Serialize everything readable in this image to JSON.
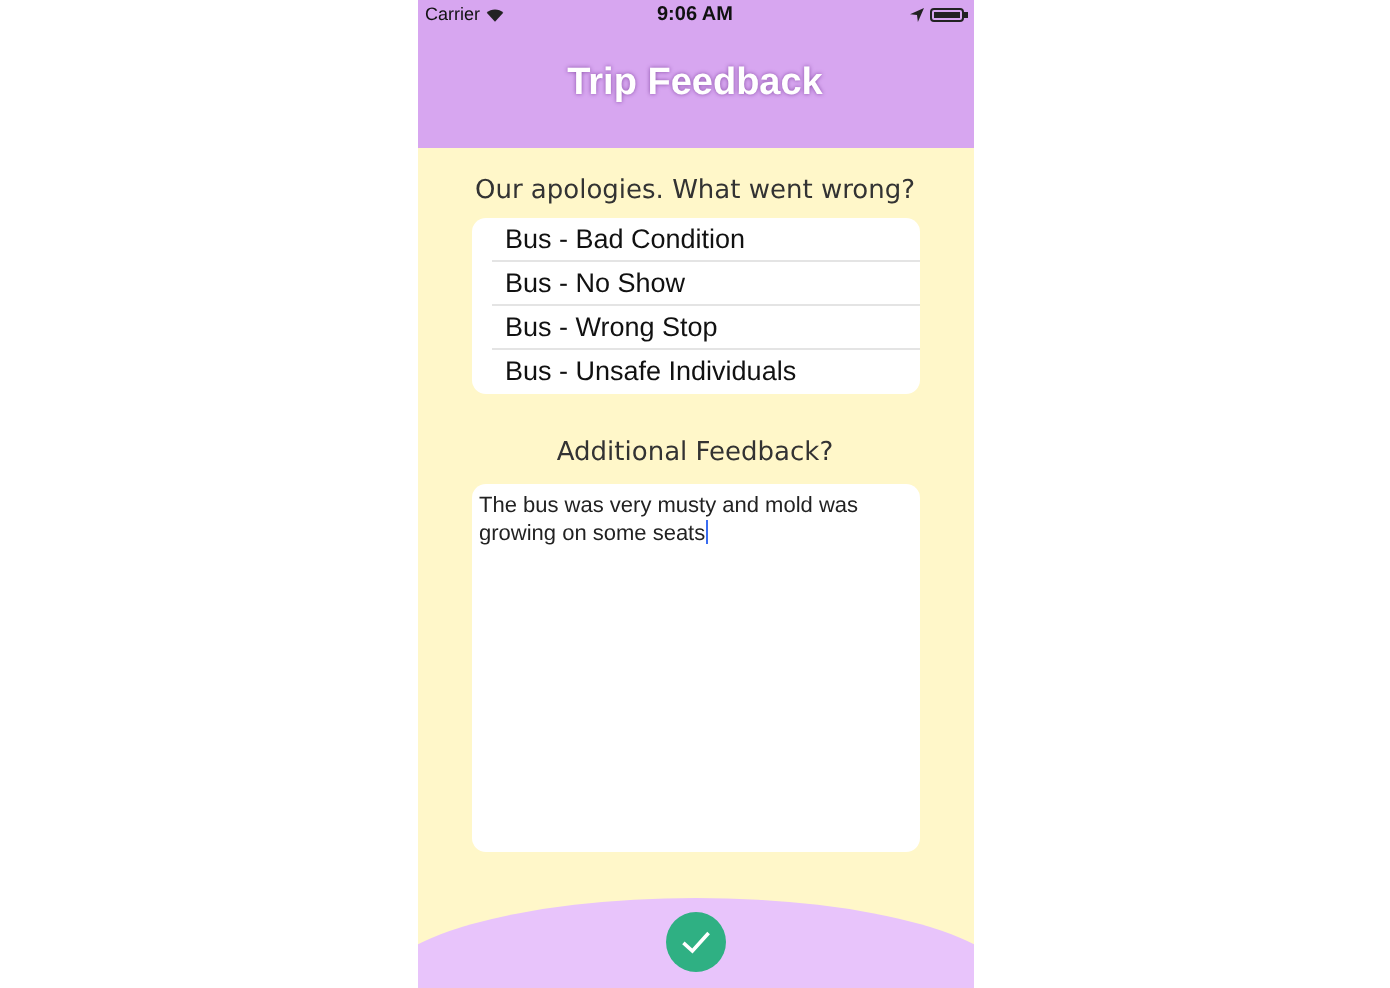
{
  "status_bar": {
    "carrier": "Carrier",
    "time": "9:06 AM"
  },
  "header": {
    "title": "Trip Feedback"
  },
  "question": "Our apologies. What went wrong?",
  "options": [
    {
      "label": "Bus - Bad Condition",
      "selected": false
    },
    {
      "label": "Bus - No Show",
      "selected": false
    },
    {
      "label": "Bus - Wrong Stop",
      "selected": false
    },
    {
      "label": "Bus - Unsafe Individuals",
      "selected": false
    }
  ],
  "feedback": {
    "label": "Additional Feedback?",
    "value": "The bus was very musty and mold was growing on some seats"
  }
}
